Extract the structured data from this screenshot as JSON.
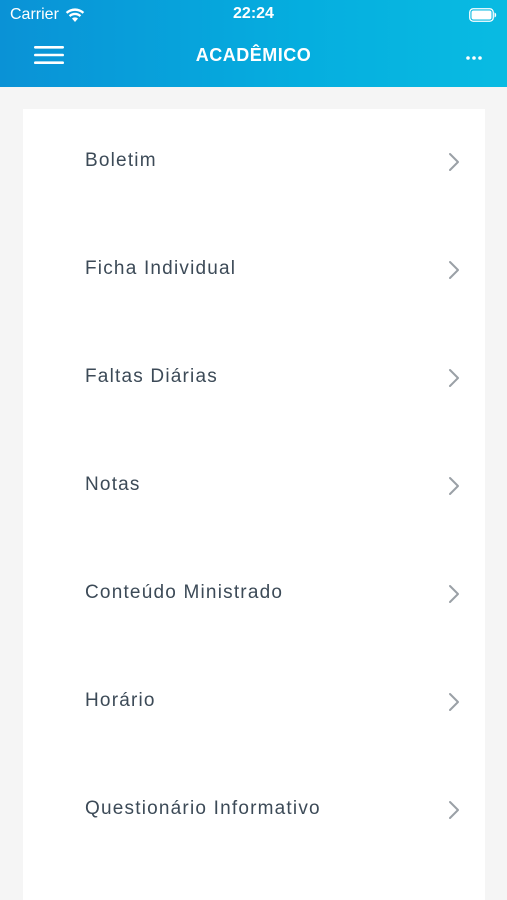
{
  "status_bar": {
    "carrier": "Carrier",
    "time": "22:24",
    "wifi_icon": "wifi-icon",
    "battery_icon": "battery-icon"
  },
  "header": {
    "title": "ACADÊMICO",
    "menu_icon": "hamburger-menu-icon",
    "more_icon": "more-dots-icon",
    "gradient_start": "#0a92d6",
    "gradient_end": "#09bbe2"
  },
  "menu": {
    "items": [
      {
        "label": "Boletim"
      },
      {
        "label": "Ficha Individual"
      },
      {
        "label": "Faltas Diárias"
      },
      {
        "label": "Notas"
      },
      {
        "label": "Conteúdo Ministrado"
      },
      {
        "label": "Horário"
      },
      {
        "label": "Questionário Informativo"
      }
    ],
    "chevron_icon": "chevron-right-icon",
    "label_color": "#3c4a57",
    "chevron_color": "#9aa0a6"
  }
}
